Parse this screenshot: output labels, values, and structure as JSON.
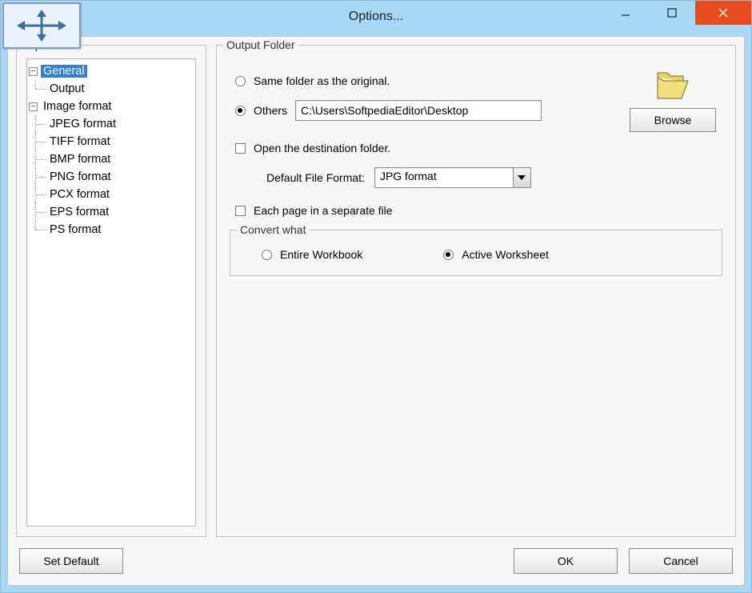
{
  "window": {
    "title": "Options..."
  },
  "tree": {
    "group_title": "Options",
    "items": {
      "general": "General",
      "output": "Output",
      "image_format": "Image format",
      "jpeg": "JPEG format",
      "tiff": "TIFF format",
      "bmp": "BMP format",
      "png": "PNG format",
      "pcx": "PCX format",
      "eps": "EPS format",
      "ps": "PS format"
    }
  },
  "output_folder": {
    "group_title": "Output Folder",
    "same_folder_label": "Same folder as the original.",
    "others_label": "Others",
    "path_value": "C:\\Users\\SoftpediaEditor\\Desktop",
    "browse_label": "Browse",
    "open_dest_label": "Open the destination folder.",
    "default_format_label": "Default File Format:",
    "default_format_value": "JPG format",
    "each_page_label": "Each page in a separate file",
    "radio_same_selected": false,
    "radio_others_selected": true,
    "open_dest_checked": false,
    "each_page_checked": false
  },
  "convert": {
    "group_title": "Convert what",
    "entire_label": "Entire Workbook",
    "active_label": "Active Worksheet",
    "entire_selected": false,
    "active_selected": true
  },
  "footer": {
    "set_default": "Set Default",
    "ok": "OK",
    "cancel": "Cancel"
  }
}
